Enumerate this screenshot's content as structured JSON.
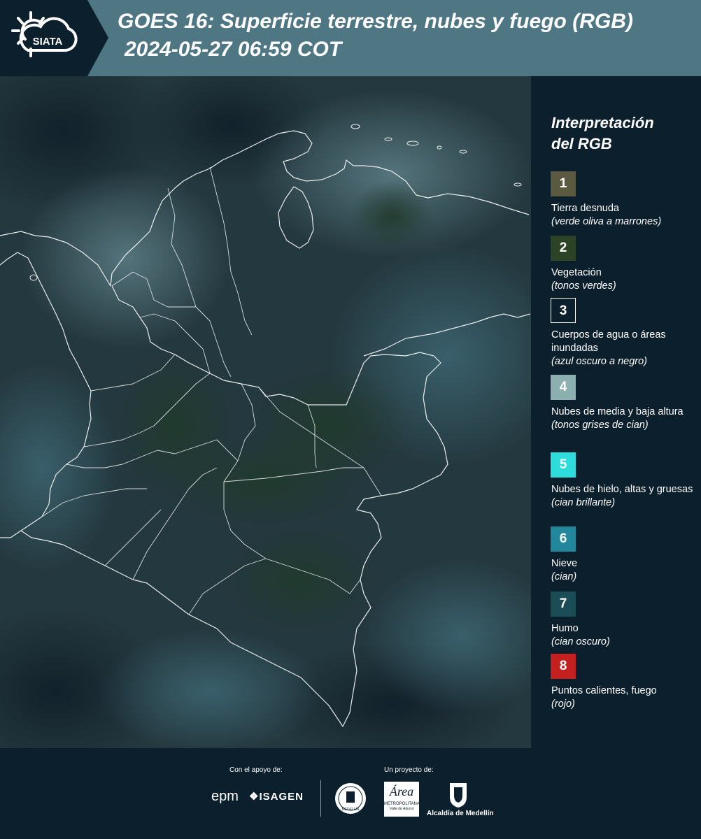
{
  "header": {
    "logo_text": "SIATA",
    "title": "GOES 16: Superficie terrestre, nubes y fuego (RGB)",
    "subtitle": "2024-05-27 06:59 COT"
  },
  "legend": {
    "title_line1": "Interpretación",
    "title_line2": "del RGB",
    "items": [
      {
        "num": "1",
        "color": "#5b5a40",
        "label": "Tierra desnuda",
        "desc": "(verde oliva a marrones)"
      },
      {
        "num": "2",
        "color": "#2c4425",
        "label": "Vegetación",
        "desc": "(tonos verdes)"
      },
      {
        "num": "3",
        "color": "#0c1f2c",
        "label": "Cuerpos de agua o áreas inundadas",
        "desc": "(azul oscuro a negro)"
      },
      {
        "num": "4",
        "color": "#8cb0b0",
        "label": "Nubes de media y baja altura",
        "desc": "(tonos grises de cian)"
      },
      {
        "num": "5",
        "color": "#2fdcdc",
        "label": "Nubes de hielo, altas y gruesas",
        "desc": "(cian brillante)"
      },
      {
        "num": "6",
        "color": "#23879c",
        "label": "Nieve",
        "desc": "(cian)"
      },
      {
        "num": "7",
        "color": "#1a4d55",
        "label": "Humo",
        "desc": "(cian oscuro)"
      },
      {
        "num": "8",
        "color": "#c42020",
        "label": "Puntos calientes, fuego",
        "desc": "(rojo)"
      }
    ]
  },
  "footer": {
    "support_label": "Con el apoyo de:",
    "project_label": "Un proyecto de:",
    "epm_logo": "epm",
    "isagen_logo": "ISAGEN",
    "amva_logo": "Área",
    "amva_sub": "METROPOLITANA",
    "amva_sub2": "Valle de Aburrá",
    "medellin_logo": "Alcaldía de Medellín",
    "uni_seal_text": "MEDELLÍN"
  }
}
